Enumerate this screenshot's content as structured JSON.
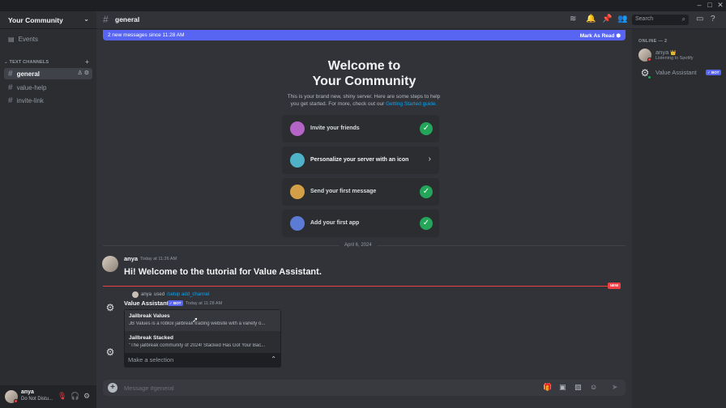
{
  "server": {
    "name": "Your Community"
  },
  "sidebar": {
    "events_label": "Events",
    "category": "TEXT CHANNELS",
    "channels": [
      {
        "name": "general"
      },
      {
        "name": "value-help"
      },
      {
        "name": "invite-link"
      }
    ]
  },
  "user": {
    "name": "anya",
    "status": "Do Not Distu..."
  },
  "topbar": {
    "channel": "general",
    "search_placeholder": "Search"
  },
  "banner": {
    "text": "2 new messages since 11:28 AM",
    "action": "Mark As Read"
  },
  "welcome": {
    "title_line1": "Welcome to",
    "title_line2": "Your Community",
    "subtitle": "This is your brand new, shiny server. Here are some steps to help you get started. For more, check out our",
    "link": "Getting Started guide.",
    "tasks": [
      {
        "label": "Invite your friends",
        "done": true
      },
      {
        "label": "Personalize your server with an icon",
        "done": false
      },
      {
        "label": "Send your first message",
        "done": true
      },
      {
        "label": "Add your first app",
        "done": true
      }
    ]
  },
  "date_divider": "April 6, 2024",
  "messages": {
    "first": {
      "author": "anya",
      "time": "Today at 11:26 AM",
      "text": "Hi! Welcome to the tutorial for Value Assistant."
    },
    "new_label": "NEW",
    "reply": {
      "user": "anya",
      "used": "used",
      "command": "/setup add_channel"
    },
    "bot": {
      "author": "Value Assistant",
      "badge": "✓ BOT",
      "time": "Today at 11:28 AM"
    }
  },
  "dropdown": {
    "options": [
      {
        "title": "Jailbreak Values",
        "desc": "JB Values is a roblox jailbreak trading website with a variety o..."
      },
      {
        "title": "Jailbreak Stacked",
        "desc": "\"The jailbreak community of 2024! Stacked Has Got Your Bac..."
      }
    ],
    "placeholder": "Make a selection"
  },
  "composer": {
    "placeholder": "Message #general"
  },
  "members": {
    "header": "ONLINE — 2",
    "list": [
      {
        "name": "anya",
        "status": "Listening to Spotify",
        "crown": "👑"
      },
      {
        "name": "Value Assistant",
        "badge": "✓ BOT"
      }
    ]
  },
  "colors": {
    "accent": "#5865f2",
    "online": "#23a55a",
    "dnd": "#f23f43",
    "link": "#00a8fc"
  }
}
